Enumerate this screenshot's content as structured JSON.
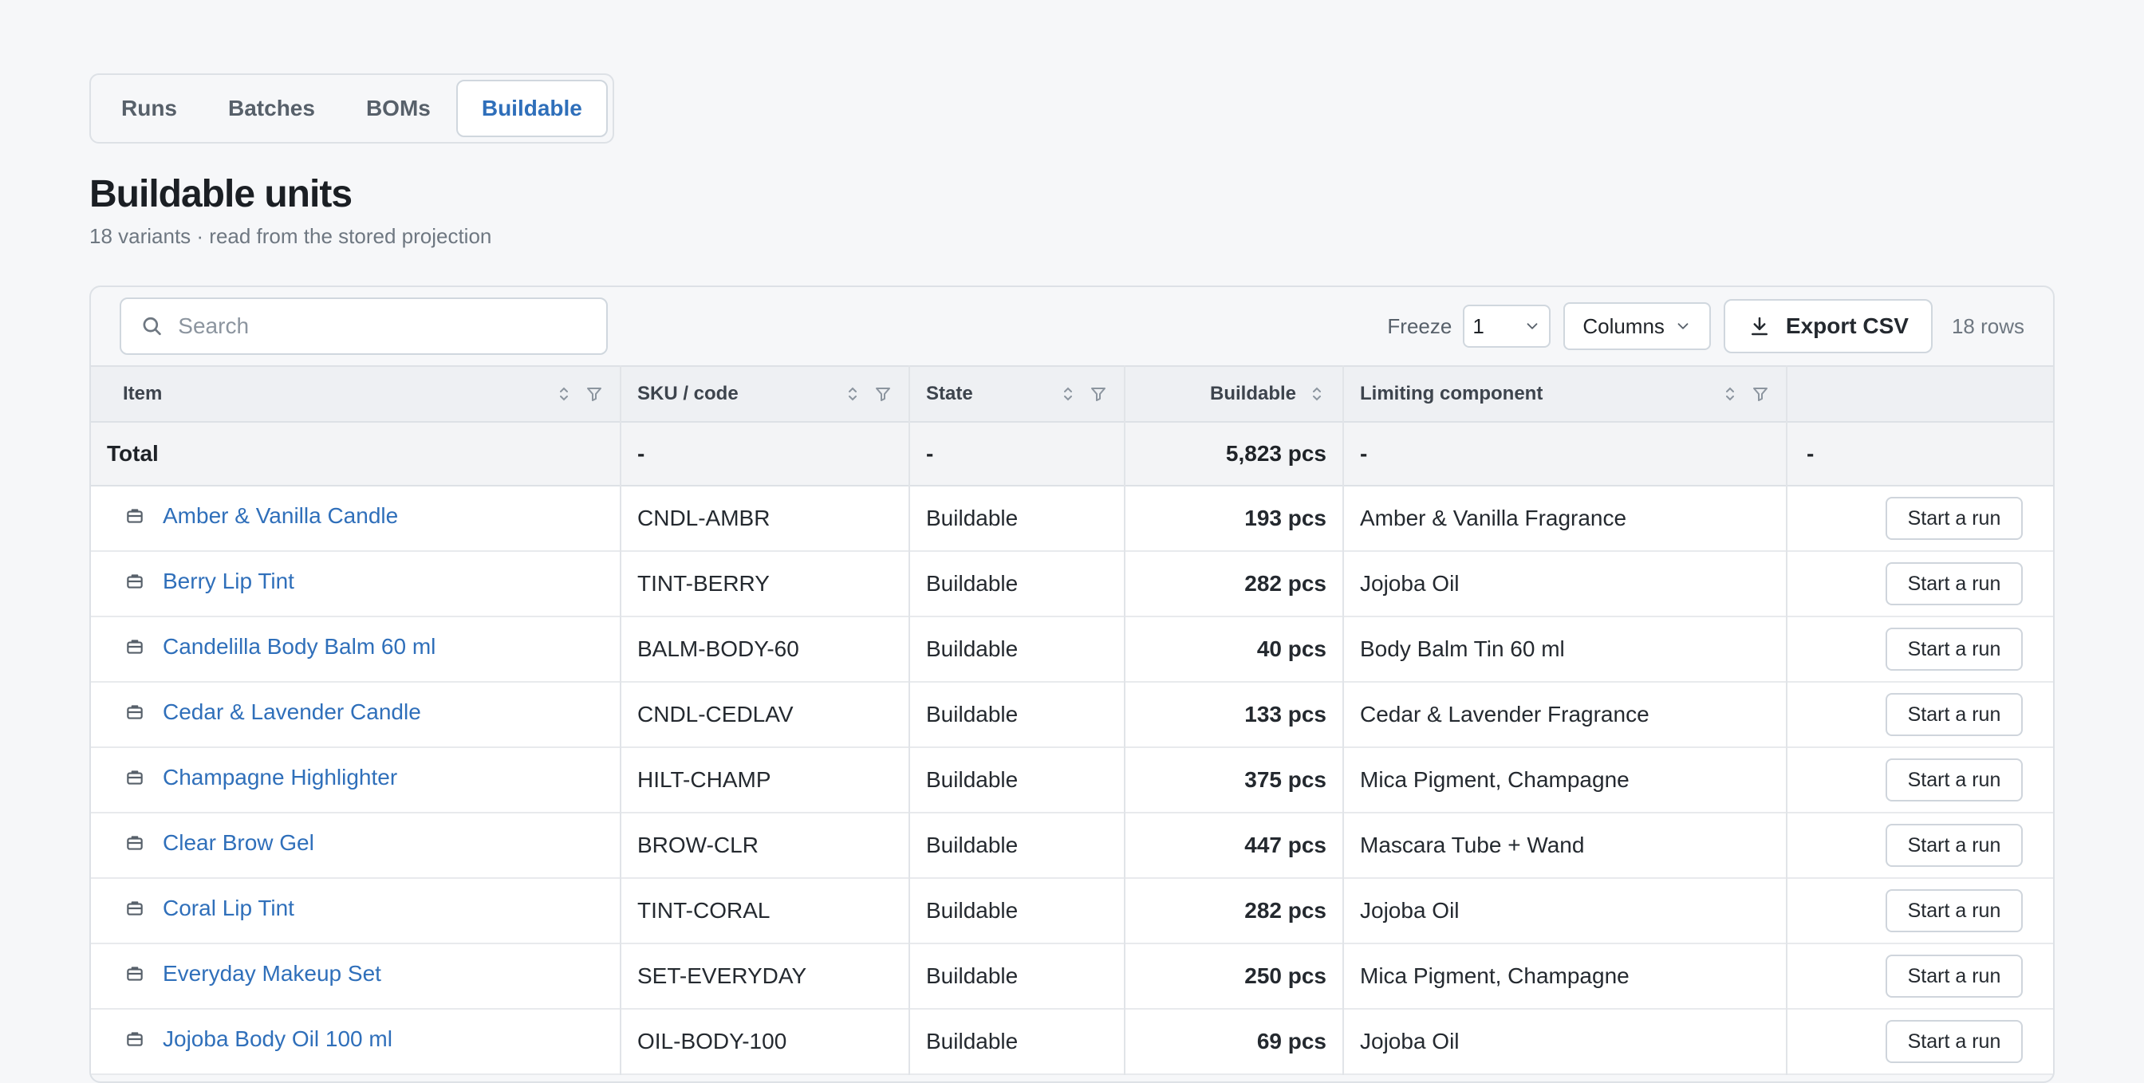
{
  "tabs": [
    {
      "label": "Runs",
      "active": false
    },
    {
      "label": "Batches",
      "active": false
    },
    {
      "label": "BOMs",
      "active": false
    },
    {
      "label": "Buildable",
      "active": true
    }
  ],
  "page": {
    "title": "Buildable units",
    "subtitle": "18 variants · read from the stored projection"
  },
  "toolbar": {
    "search_placeholder": "Search",
    "search_value": "",
    "freeze_label": "Freeze",
    "freeze_value": "1",
    "columns_label": "Columns",
    "export_label": "Export CSV",
    "row_count": "18 rows"
  },
  "columns": [
    {
      "label": "Item"
    },
    {
      "label": "SKU / code"
    },
    {
      "label": "State"
    },
    {
      "label": "Buildable"
    },
    {
      "label": "Limiting component"
    },
    {
      "label": ""
    }
  ],
  "total": {
    "label": "Total",
    "sku": "-",
    "state": "-",
    "buildable": "5,823 pcs",
    "limiting": "-",
    "action": "-"
  },
  "rows": [
    {
      "item": "Amber & Vanilla Candle",
      "sku": "CNDL-AMBR",
      "state": "Buildable",
      "buildable": "193 pcs",
      "limiting": "Amber & Vanilla Fragrance",
      "action": "Start a run"
    },
    {
      "item": "Berry Lip Tint",
      "sku": "TINT-BERRY",
      "state": "Buildable",
      "buildable": "282 pcs",
      "limiting": "Jojoba Oil",
      "action": "Start a run"
    },
    {
      "item": "Candelilla Body Balm 60 ml",
      "sku": "BALM-BODY-60",
      "state": "Buildable",
      "buildable": "40 pcs",
      "limiting": "Body Balm Tin 60 ml",
      "action": "Start a run"
    },
    {
      "item": "Cedar & Lavender Candle",
      "sku": "CNDL-CEDLAV",
      "state": "Buildable",
      "buildable": "133 pcs",
      "limiting": "Cedar & Lavender Fragrance",
      "action": "Start a run"
    },
    {
      "item": "Champagne Highlighter",
      "sku": "HILT-CHAMP",
      "state": "Buildable",
      "buildable": "375 pcs",
      "limiting": "Mica Pigment, Champagne",
      "action": "Start a run"
    },
    {
      "item": "Clear Brow Gel",
      "sku": "BROW-CLR",
      "state": "Buildable",
      "buildable": "447 pcs",
      "limiting": "Mascara Tube + Wand",
      "action": "Start a run"
    },
    {
      "item": "Coral Lip Tint",
      "sku": "TINT-CORAL",
      "state": "Buildable",
      "buildable": "282 pcs",
      "limiting": "Jojoba Oil",
      "action": "Start a run"
    },
    {
      "item": "Everyday Makeup Set",
      "sku": "SET-EVERYDAY",
      "state": "Buildable",
      "buildable": "250 pcs",
      "limiting": "Mica Pigment, Champagne",
      "action": "Start a run"
    },
    {
      "item": "Jojoba Body Oil 100 ml",
      "sku": "OIL-BODY-100",
      "state": "Buildable",
      "buildable": "69 pcs",
      "limiting": "Jojoba Oil",
      "action": "Start a run"
    }
  ],
  "colors": {
    "accent": "#2f6fba",
    "background": "#f6f7f9",
    "border": "#dde1e6"
  },
  "icons": {
    "search": "search-icon",
    "export": "download-icon",
    "item": "package-icon",
    "sort": "sort-icon",
    "filter": "filter-icon",
    "chevron": "chevron-down-icon"
  }
}
